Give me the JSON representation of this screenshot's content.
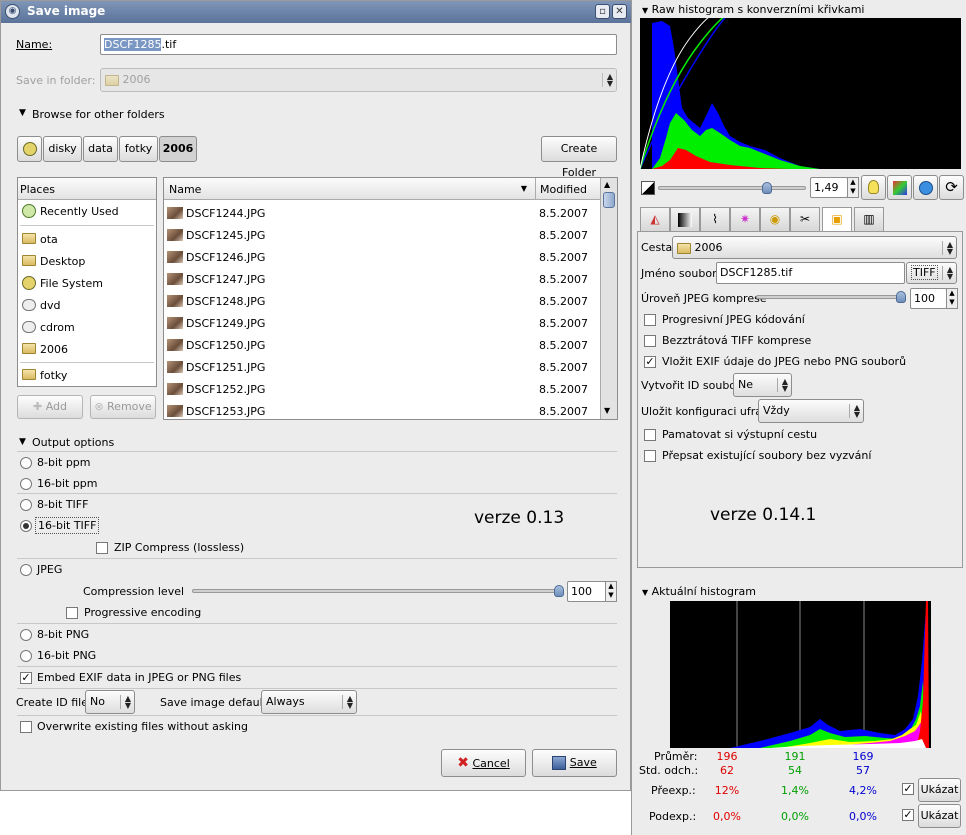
{
  "left": {
    "title": "Save image",
    "name_label": "Name:",
    "name_value_selected": "DSCF1285",
    "name_value_rest": ".tif",
    "save_in_folder_label": "Save in folder:",
    "save_in_folder_value": "2006",
    "browse_label": "Browse for other folders",
    "path_buttons": [
      "disky",
      "data",
      "fotky",
      "2006"
    ],
    "create_folder": "Create Folder",
    "places_header": "Places",
    "places": [
      "Recently Used",
      "ota",
      "Desktop",
      "File System",
      "dvd",
      "cdrom",
      "2006",
      "fotky"
    ],
    "add_button": "Add",
    "remove_button": "Remove",
    "col_name": "Name",
    "col_modified": "Modified",
    "files": [
      {
        "name": "DSCF1244.JPG",
        "date": "8.5.2007"
      },
      {
        "name": "DSCF1245.JPG",
        "date": "8.5.2007"
      },
      {
        "name": "DSCF1246.JPG",
        "date": "8.5.2007"
      },
      {
        "name": "DSCF1247.JPG",
        "date": "8.5.2007"
      },
      {
        "name": "DSCF1248.JPG",
        "date": "8.5.2007"
      },
      {
        "name": "DSCF1249.JPG",
        "date": "8.5.2007"
      },
      {
        "name": "DSCF1250.JPG",
        "date": "8.5.2007"
      },
      {
        "name": "DSCF1251.JPG",
        "date": "8.5.2007"
      },
      {
        "name": "DSCF1252.JPG",
        "date": "8.5.2007"
      },
      {
        "name": "DSCF1253.JPG",
        "date": "8.5.2007"
      }
    ],
    "output_options_label": "Output options",
    "opt_8bit_ppm": "8-bit ppm",
    "opt_16bit_ppm": "16-bit ppm",
    "opt_8bit_tiff": "8-bit TIFF",
    "opt_16bit_tiff": "16-bit TIFF",
    "zip_compress": "ZIP Compress (lossless)",
    "opt_jpeg": "JPEG",
    "compression_level_label": "Compression level",
    "compression_level_value": "100",
    "compression_level_fraction": 1.0,
    "progressive_encoding": "Progressive encoding",
    "opt_8bit_png": "8-bit PNG",
    "opt_16bit_png": "16-bit PNG",
    "embed_exif": "Embed EXIF data in JPEG or PNG files",
    "create_id_label": "Create ID file",
    "create_id_value": "No",
    "save_defaults_label": "Save image defaults",
    "save_defaults_value": "Always",
    "overwrite_label": "Overwrite existing files without asking",
    "cancel_button": "Cancel",
    "save_button": "Save",
    "version_label": "verze 0.13"
  },
  "right": {
    "raw_hist_title": "Raw histogram s konverzními křivkami",
    "exposure_value": "1,49",
    "exposure_fraction": 0.75,
    "cesta_label": "Cesta",
    "cesta_value": "2006",
    "filename_label": "Jméno souboru",
    "filename_value": "DSCF1285.tif",
    "format_value": "TIFF",
    "jpeg_compression_label": "Úroveň JPEG komprese",
    "jpeg_compression_value": "100",
    "jpeg_compression_fraction": 1.0,
    "progressive_jpeg": "Progresivní JPEG kódování",
    "lossless_tiff": "Bezztrátová TIFF komprese",
    "embed_exif": "Vložit EXIF údaje do JPEG nebo PNG souborů",
    "create_id_label": "Vytvořit ID soubor",
    "create_id_value": "Ne",
    "save_config_label": "Uložit konfiguraci ufraw",
    "save_config_value": "Vždy",
    "remember_path": "Pamatovat si výstupní cestu",
    "overwrite_existing": "Přepsat existující soubory bez vyzvání",
    "version_label": "verze 0.14.1",
    "actual_hist_title": "Aktuální histogram",
    "mean_label": "Průměr:",
    "mean_values": [
      "196",
      "191",
      "169"
    ],
    "std_label": "Std. odch.:",
    "std_values": [
      "62",
      "54",
      "57"
    ],
    "overexp_label": "Přeexp.:",
    "overexp_values": [
      "12%",
      "1,4%",
      "4,2%"
    ],
    "underexp_label": "Podexp.:",
    "underexp_values": [
      "0,0%",
      "0,0%",
      "0,0%"
    ],
    "show_button": "Ukázat"
  },
  "colors": {
    "red": "#e00000",
    "green": "#00a000",
    "blue": "#0000d0",
    "title_bar": "#6a82a8"
  }
}
